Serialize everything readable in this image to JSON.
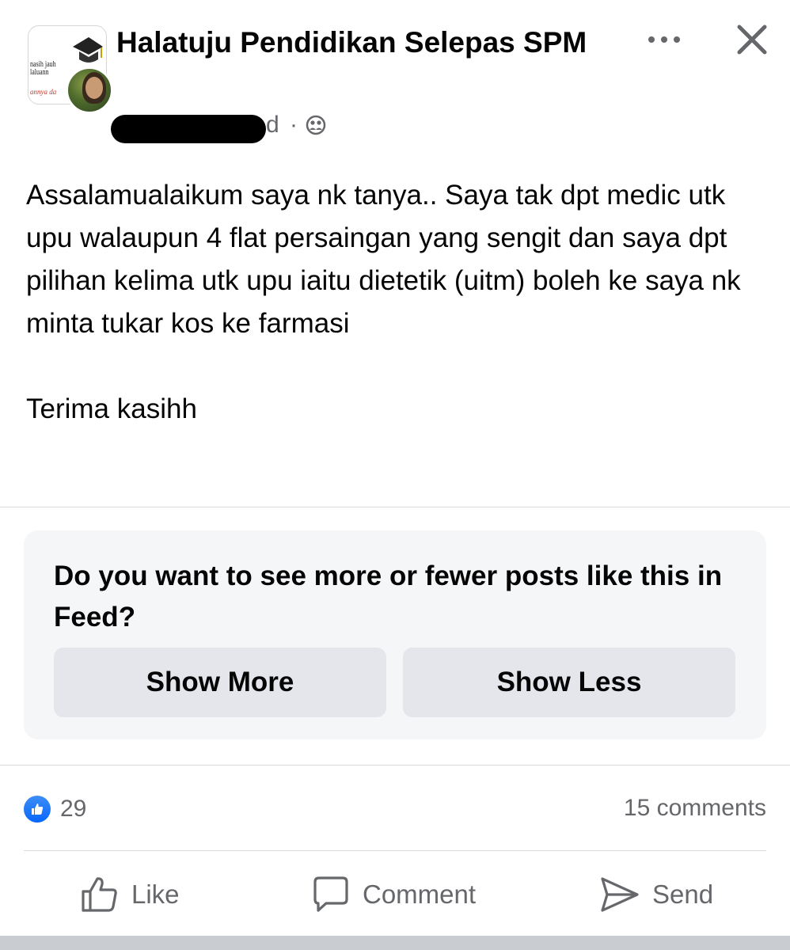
{
  "header": {
    "group_name": "Halatuju Pendidikan Selepas SPM",
    "post_time": "d",
    "separator": "·",
    "privacy_icon": "group-privacy-icon",
    "more_icon": "more-dots-icon",
    "close_icon": "close-x-icon",
    "avatar_logo_text": [
      "nasih jauh",
      "laluann",
      "annya da"
    ]
  },
  "post": {
    "body": "Assalamualaikum saya nk tanya.. Saya tak dpt medic utk upu walaupun 4 flat persaingan yang sengit dan saya dpt pilihan kelima utk upu iaitu dietetik (uitm) boleh ke saya nk minta tukar kos ke farmasi\n\nTerima kasihh"
  },
  "feedback": {
    "question": "Do you want to see more or fewer posts like this in Feed?",
    "show_more": "Show More",
    "show_less": "Show Less"
  },
  "stats": {
    "reaction_icon": "like-reaction-icon",
    "reaction_count": "29",
    "comments": "15 comments"
  },
  "actions": {
    "like": "Like",
    "comment": "Comment",
    "send": "Send"
  },
  "colors": {
    "text_primary": "#050505",
    "text_secondary": "#65676b",
    "card_bg": "#f5f6f8",
    "button_bg": "#e4e6eb",
    "like_blue": "#0866ff",
    "divider": "#d7d9dd"
  }
}
